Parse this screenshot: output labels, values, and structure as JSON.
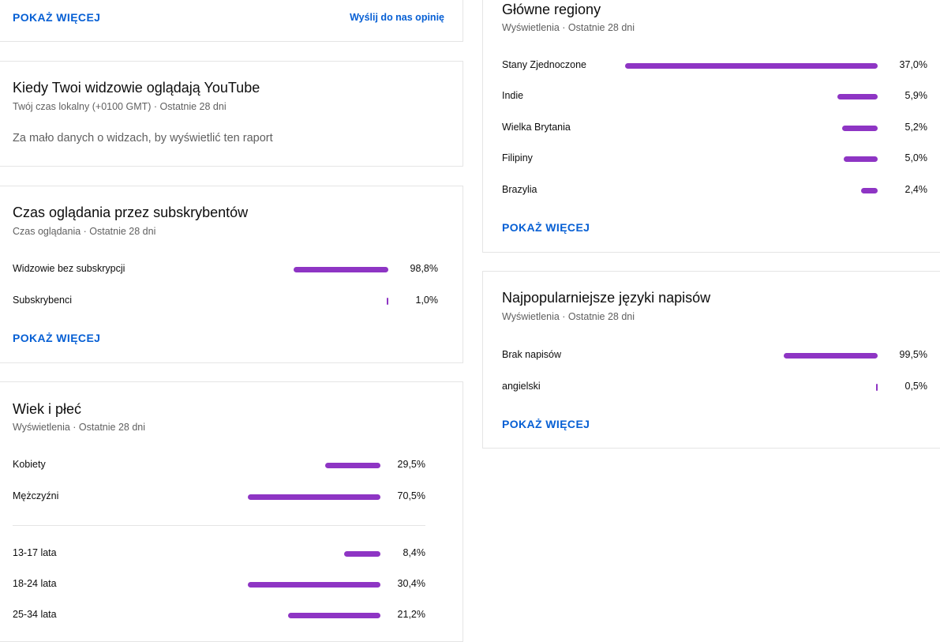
{
  "top_card": {
    "more_label": "POKAŻ WIĘCEJ",
    "feedback_label": "Wyślij do nas opinię"
  },
  "when_watch": {
    "title": "Kiedy Twoi widzowie oglądają YouTube",
    "subtitle": "Twój czas lokalny (+0100 GMT) · Ostatnie 28 dni",
    "message": "Za mało danych o widzach, by wyświetlić ten raport"
  },
  "subscribers": {
    "title": "Czas oglądania przez subskrybentów",
    "subtitle": "Czas oglądania · Ostatnie 28 dni",
    "rows": [
      {
        "label": "Widzowie bez subskrypcji",
        "value": "98,8%",
        "fraction": 0.988
      },
      {
        "label": "Subskrybenci",
        "value": "1,0%",
        "fraction": 0.01
      }
    ],
    "more_label": "POKAŻ WIĘCEJ"
  },
  "age_gender": {
    "title": "Wiek i płeć",
    "subtitle": "Wyświetlenia · Ostatnie 28 dni",
    "gender_rows": [
      {
        "label": "Kobiety",
        "value": "29,5%",
        "fraction": 0.295
      },
      {
        "label": "Mężczyźni",
        "value": "70,5%",
        "fraction": 0.705
      }
    ],
    "age_rows": [
      {
        "label": "13-17 lata",
        "value": "8,4%",
        "fraction": 0.084
      },
      {
        "label": "18-24 lata",
        "value": "30,4%",
        "fraction": 0.304
      },
      {
        "label": "25-34 lata",
        "value": "21,2%",
        "fraction": 0.212
      }
    ]
  },
  "regions": {
    "title": "Główne regiony",
    "subtitle": "Wyświetlenia · Ostatnie 28 dni",
    "rows": [
      {
        "label": "Stany Zjednoczone",
        "value": "37,0%",
        "fraction": 0.37
      },
      {
        "label": "Indie",
        "value": "5,9%",
        "fraction": 0.059
      },
      {
        "label": "Wielka Brytania",
        "value": "5,2%",
        "fraction": 0.052
      },
      {
        "label": "Filipiny",
        "value": "5,0%",
        "fraction": 0.05
      },
      {
        "label": "Brazylia",
        "value": "2,4%",
        "fraction": 0.024
      }
    ],
    "more_label": "POKAŻ WIĘCEJ"
  },
  "subtitles": {
    "title": "Najpopularniejsze języki napisów",
    "subtitle": "Wyświetlenia · Ostatnie 28 dni",
    "rows": [
      {
        "label": "Brak napisów",
        "value": "99,5%",
        "fraction": 0.995
      },
      {
        "label": "angielski",
        "value": "0,5%",
        "fraction": 0.005
      }
    ],
    "more_label": "POKAŻ WIĘCEJ"
  },
  "colors": {
    "bar": "#8e35c4",
    "link": "#065fd4"
  }
}
